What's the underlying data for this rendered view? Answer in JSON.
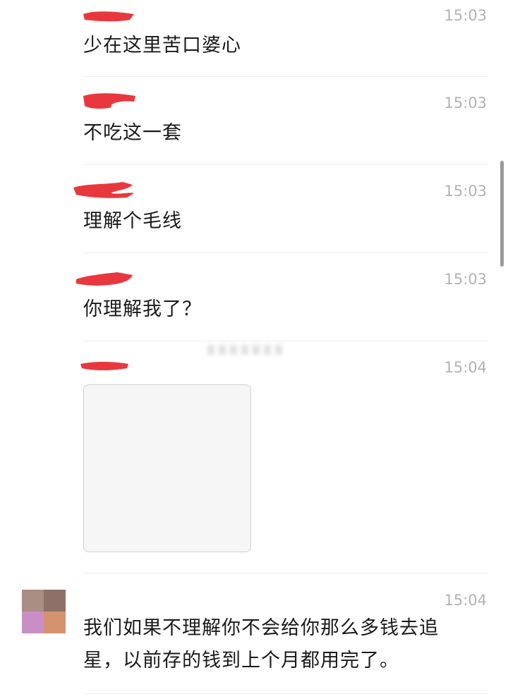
{
  "messages": [
    {
      "time": "15:03",
      "text": "少在这里苦口婆心"
    },
    {
      "time": "15:03",
      "text": "不吃这一套"
    },
    {
      "time": "15:03",
      "text": "理解个毛线"
    },
    {
      "time": "15:03",
      "text": "你理解我了？"
    },
    {
      "time": "15:04",
      "text": ""
    },
    {
      "time": "15:04",
      "text": "我们如果不理解你不会给你那么多钱去追星，以前存的钱到上个月都用完了。"
    }
  ],
  "colors": {
    "redact": "#e8383d",
    "timestamp": "#b2b2b2",
    "text": "#1a1a1a",
    "avatar": [
      "#a98e84",
      "#8e7068",
      "#c98fc4",
      "#d5926f"
    ]
  },
  "icons": {
    "image_message": "image-placeholder-icon"
  }
}
